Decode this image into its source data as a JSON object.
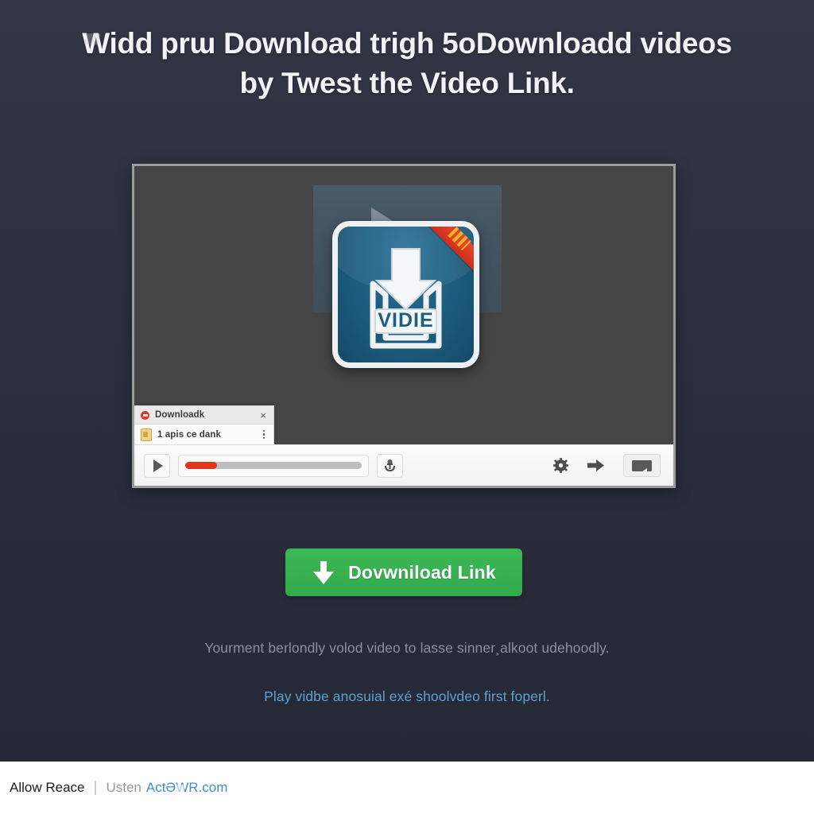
{
  "headline": {
    "line1": "Widd prɯ Download trigh 5oDownloadd videos",
    "line2": "by Twest the Video Link."
  },
  "player": {
    "icon_label": "VIDIE",
    "download_popup": {
      "title": "Downloadk",
      "close_label": "×",
      "item_label": "1 apis ce dank"
    },
    "progress_percent": 18
  },
  "cta": {
    "label": "Dovwniload Link",
    "icon": "download-arrow-icon",
    "color": "#3cb856"
  },
  "notes": {
    "description": "Yourment berlondly volod video to lasse sinner¸alkoot udehoodly.",
    "link": "Play vidbe anosuial exé shoolvdeo first foperl."
  },
  "footer": {
    "primary": "Allow Reace",
    "separator": "|",
    "muted": "Usten",
    "link": "ActƏWR.com"
  }
}
